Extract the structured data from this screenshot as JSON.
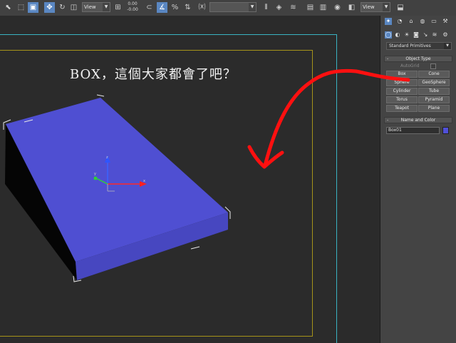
{
  "toolbar": {
    "ref_coord_system": "View",
    "spinner_value": "0.00",
    "spinner_value2": "-0.00",
    "selection_set": "",
    "render_view": "View"
  },
  "viewport": {
    "caption": "BOX，這個大家都會了吧？"
  },
  "command_panel": {
    "category": "Standard Primitives",
    "object_type": {
      "header": "Object Type",
      "autogrid_label": "AutoGrid",
      "buttons": [
        "Box",
        "Cone",
        "Sphere",
        "GeoSphere",
        "Cylinder",
        "Tube",
        "Torus",
        "Pyramid",
        "Teapot",
        "Plane"
      ]
    },
    "name_and_color": {
      "header": "Name and Color",
      "object_name": "Box01",
      "object_color": "#5050d8"
    }
  },
  "colors": {
    "box_top": "#4f4fd2",
    "box_front": "#4747c0",
    "box_side": "#050505",
    "annotation_red": "#ff1010",
    "safe_frame": "#39b3c3",
    "render_frame": "#a6931a"
  }
}
